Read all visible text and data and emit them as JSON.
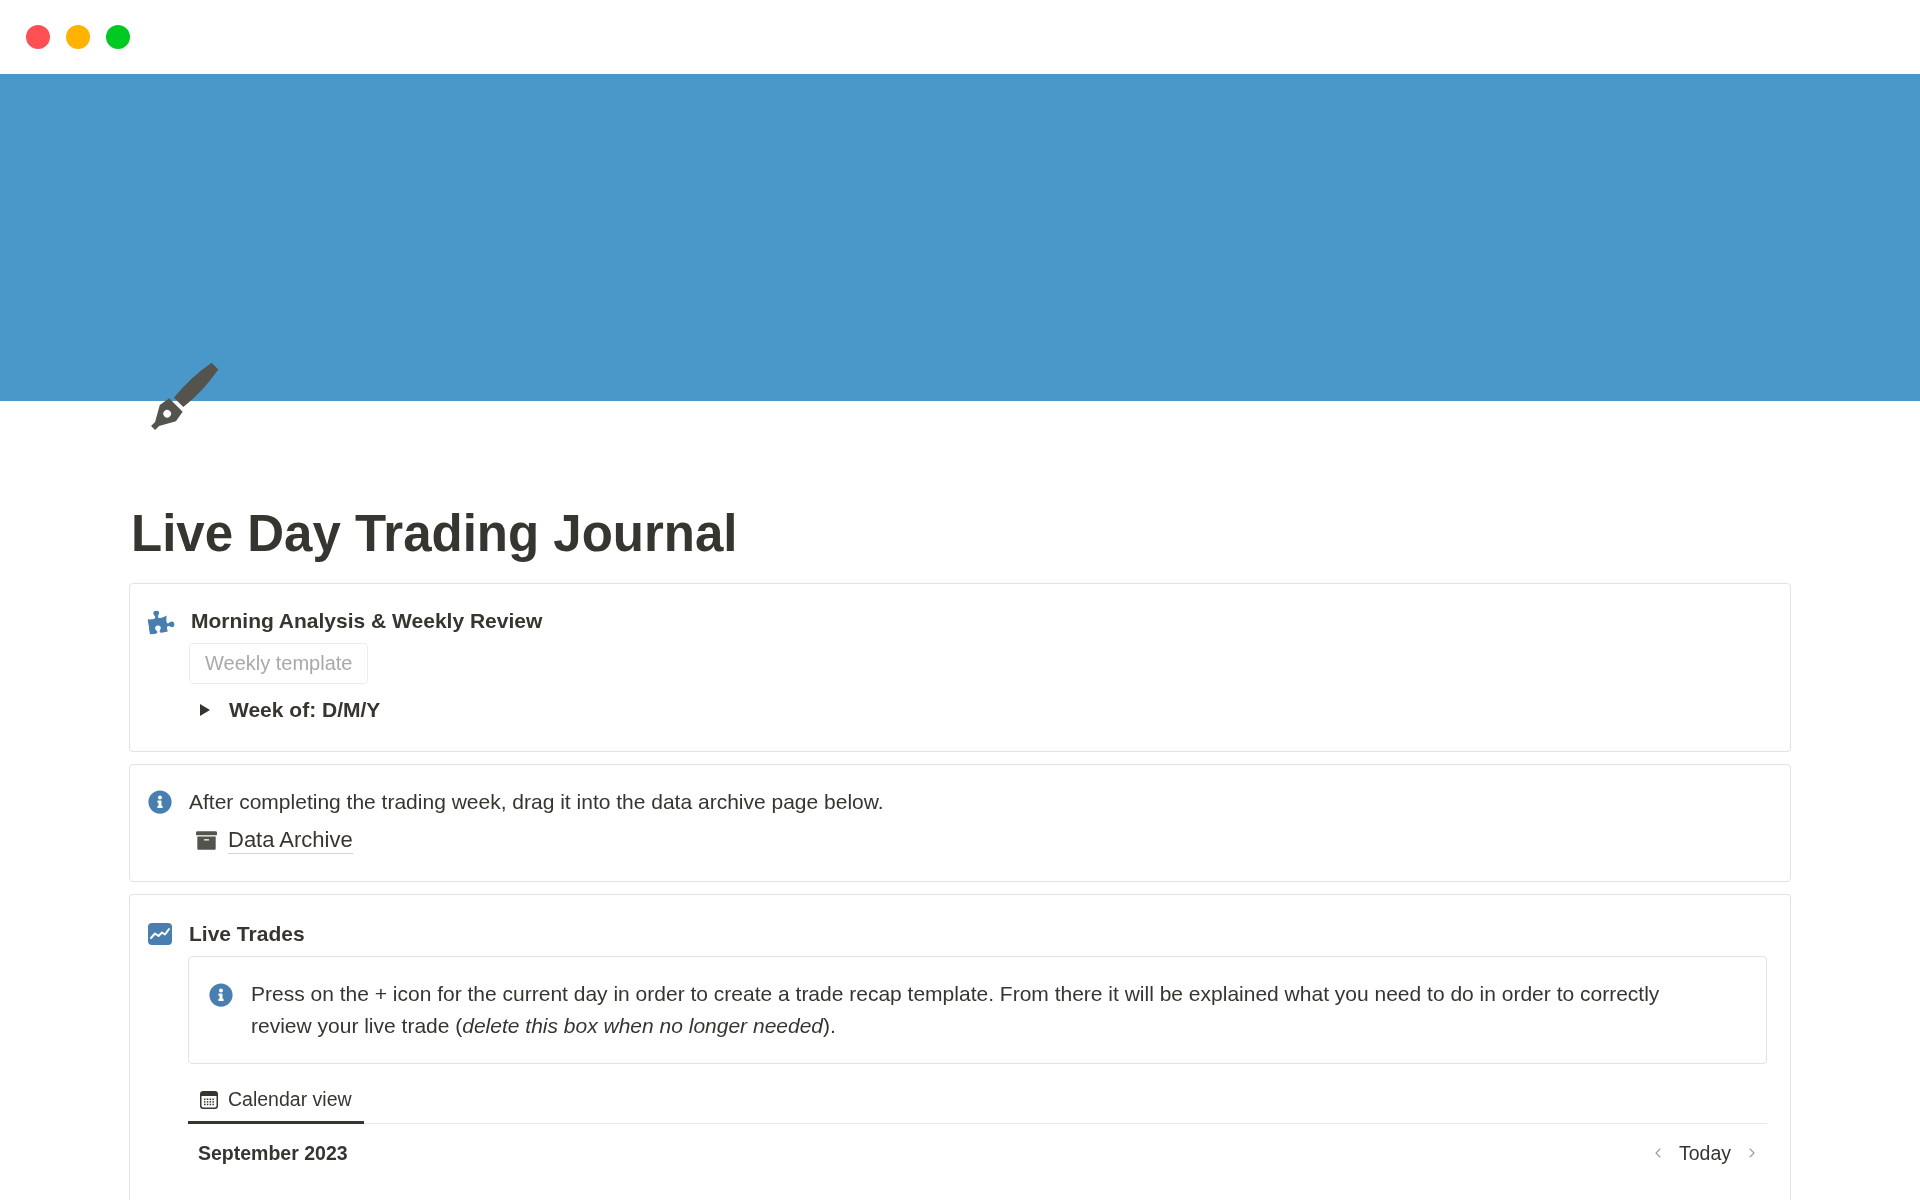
{
  "window": {
    "controls": [
      {
        "color": "#fe4f52"
      },
      {
        "color": "#ffb300"
      },
      {
        "color": "#00ca22"
      }
    ]
  },
  "page": {
    "title": "Live Day Trading Journal",
    "blocks": [
      {
        "kind": "template",
        "heading": "Morning Analysis & Weekly Review",
        "template_button": "Weekly template",
        "toggles": [
          {
            "label": "Week of: D/M/Y",
            "expanded": false
          }
        ]
      },
      {
        "kind": "note",
        "text": "After completing the trading week, drag it into the data archive page below.",
        "links": [
          {
            "label": "Data Archive"
          }
        ]
      },
      {
        "kind": "database",
        "heading": "Live Trades",
        "callout": {
          "text": "Press on the + icon for the current day in order to create a trade recap template. From there it will be explained what you need to do in order to correctly review your live trade (*delete this box when no longer needed*)."
        },
        "views": [
          {
            "label": "Calendar view",
            "selected": true
          }
        ],
        "calendar": {
          "month": "September 2023",
          "today_button": "Today"
        }
      }
    ]
  }
}
